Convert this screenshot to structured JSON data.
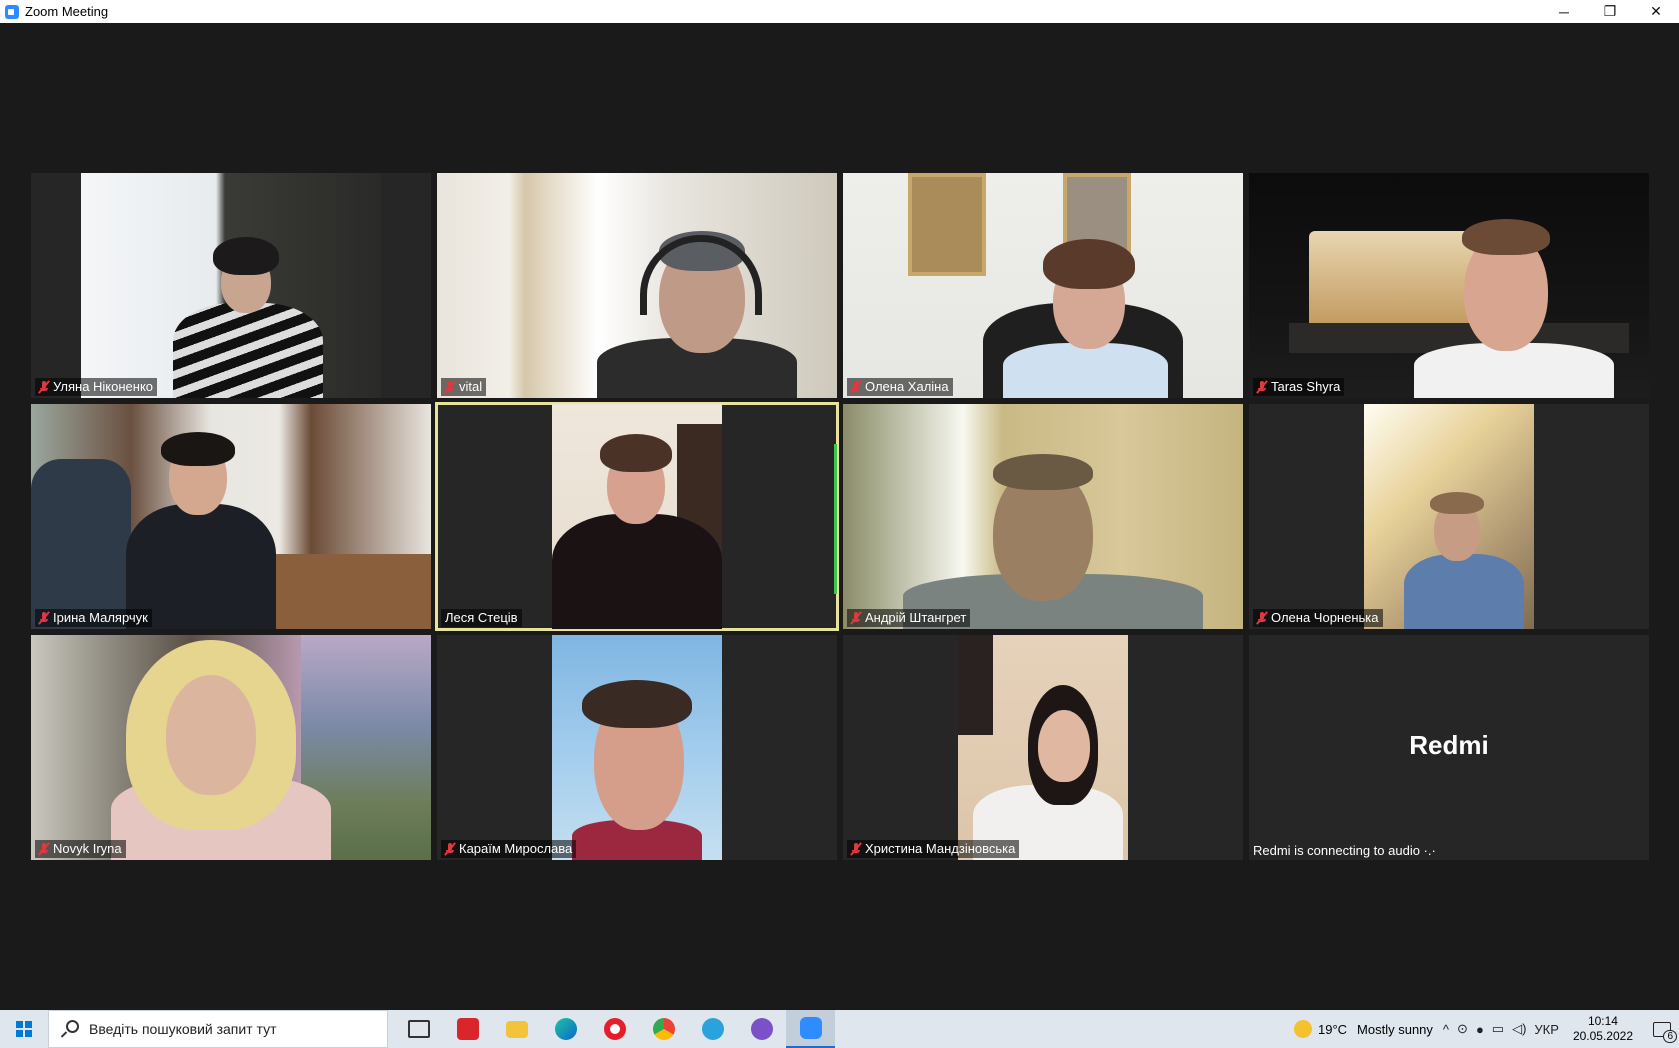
{
  "window": {
    "title": "Zoom Meeting",
    "minimize": "─",
    "restore": "❐",
    "close": "✕"
  },
  "participants": [
    {
      "name": "Уляна Ніконенко",
      "muted": true
    },
    {
      "name": "vital",
      "muted": true
    },
    {
      "name": "Олена Халіна",
      "muted": true
    },
    {
      "name": "Taras Shyra",
      "muted": true
    },
    {
      "name": "Ірина Малярчук",
      "muted": true
    },
    {
      "name": "Леся Стеців",
      "muted": false,
      "active_speaker": true
    },
    {
      "name": "Андрій Штангрет",
      "muted": true
    },
    {
      "name": "Олена Чорненька",
      "muted": true
    },
    {
      "name": "Novyk Iryna",
      "muted": true
    },
    {
      "name": "Караїм Мирослава",
      "muted": true
    },
    {
      "name": "Христина Мандзіновська",
      "muted": true
    },
    {
      "name": "Redmi",
      "video_off": true,
      "status": "Redmi is connecting to audio ·.·"
    }
  ],
  "taskbar": {
    "search_placeholder": "Введіть пошуковий запит тут",
    "apps": [
      "task-view-icon",
      "pdf-app-icon",
      "file-explorer-icon",
      "edge-icon",
      "opera-icon",
      "chrome-icon",
      "telegram-icon",
      "viber-icon",
      "zoom-icon"
    ],
    "weather": {
      "temp": "19°C",
      "condition": "Mostly sunny"
    },
    "language": "УКР",
    "time": "10:14",
    "date": "20.05.2022",
    "notifications": "6"
  }
}
